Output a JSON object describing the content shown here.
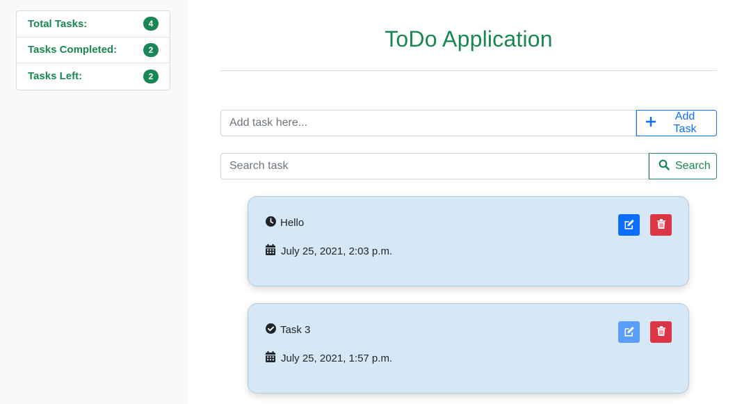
{
  "stats": [
    {
      "label": "Total Tasks:",
      "count": "4"
    },
    {
      "label": "Tasks Completed:",
      "count": "2"
    },
    {
      "label": "Tasks Left:",
      "count": "2"
    }
  ],
  "header": {
    "title": "ToDo Application"
  },
  "add_task": {
    "placeholder": "Add task here...",
    "button_label": "Add Task"
  },
  "search": {
    "placeholder": "Search task",
    "button_label": "Search"
  },
  "tasks": [
    {
      "title": "Hello",
      "status_icon": "clock-icon",
      "date": "July 25, 2021, 2:03 p.m.",
      "edit_enabled": true
    },
    {
      "title": "Task 3",
      "status_icon": "check-circle-icon",
      "date": "July 25, 2021, 1:57 p.m.",
      "edit_enabled": false
    }
  ],
  "colors": {
    "accent": "#198754",
    "primary": "#0d6efd",
    "danger": "#dc3545",
    "card_bg": "#d6e8f6"
  }
}
